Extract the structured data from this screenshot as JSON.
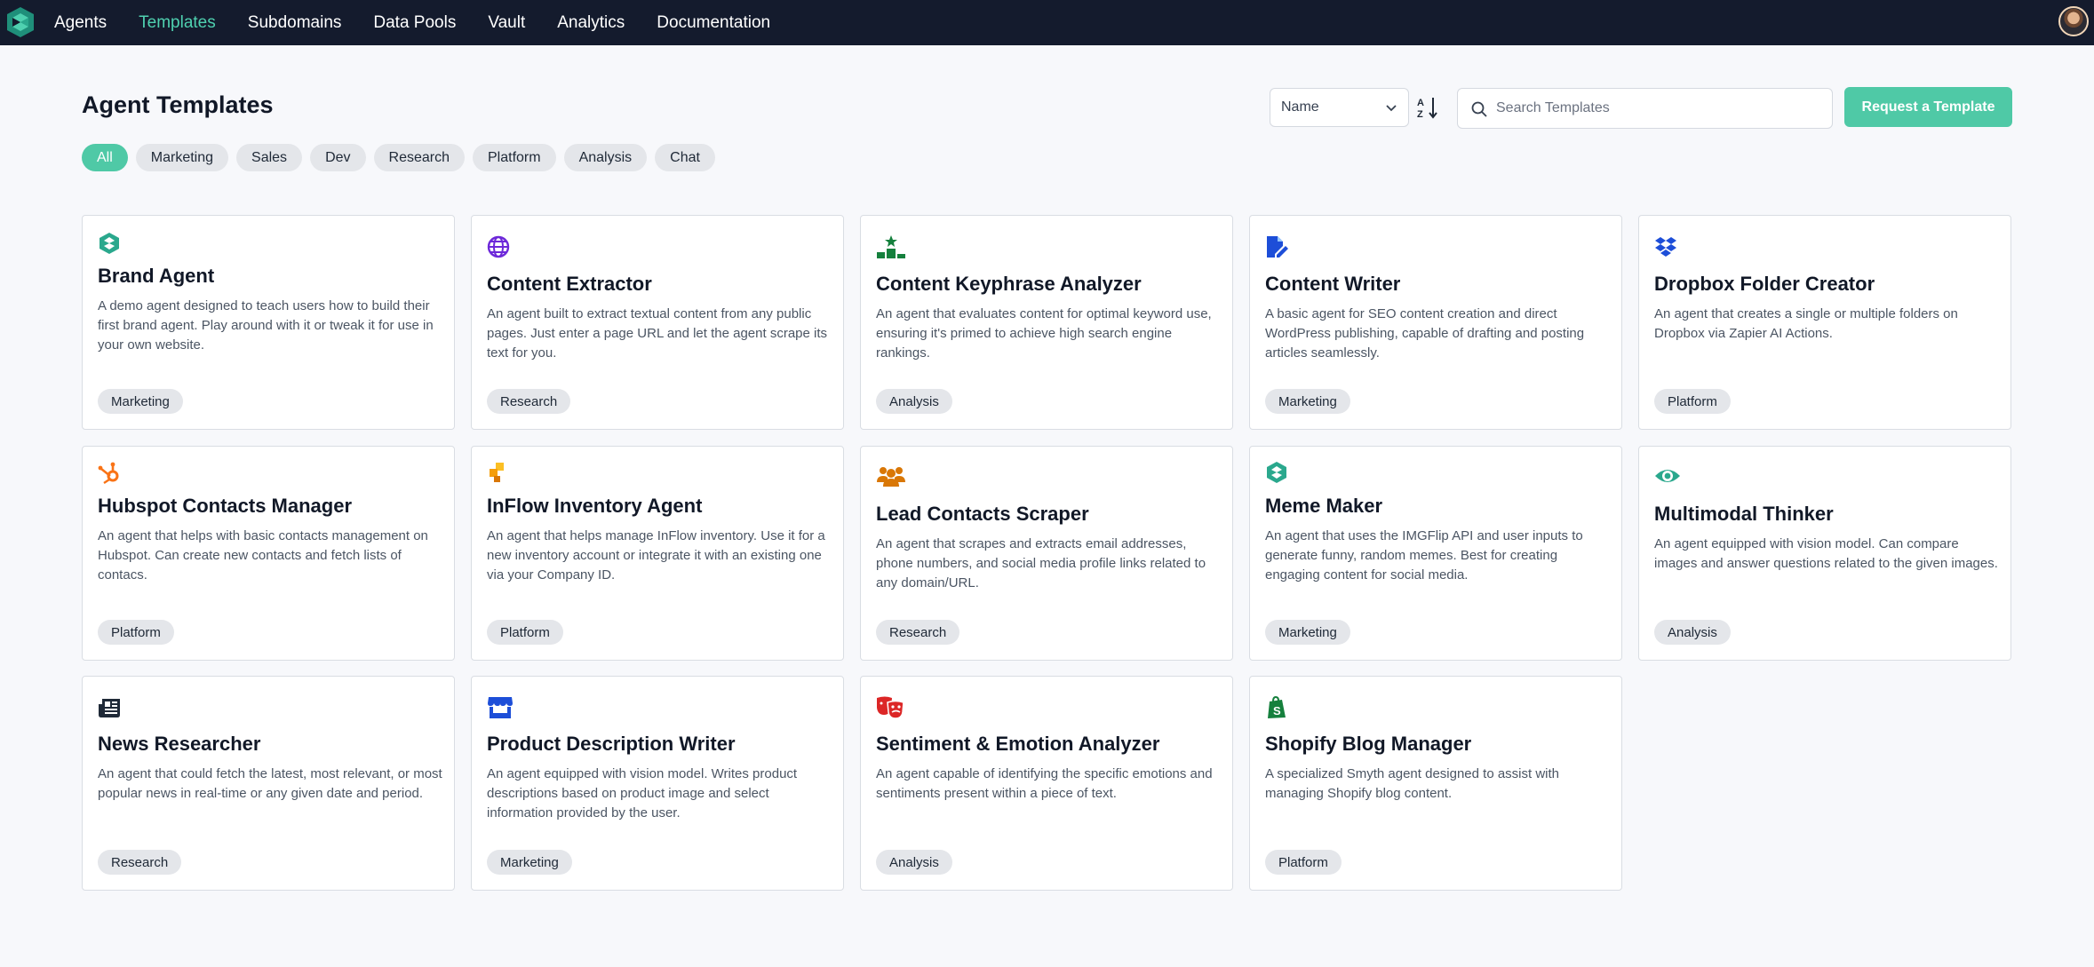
{
  "nav": {
    "items": [
      "Agents",
      "Templates",
      "Subdomains",
      "Data Pools",
      "Vault",
      "Analytics",
      "Documentation"
    ],
    "active": "Templates",
    "accent": "#4fd1b0",
    "background": "#141b2d"
  },
  "header": {
    "title": "Agent Templates",
    "sort_value": "Name",
    "search_placeholder": "Search Templates",
    "request_button": "Request a Template",
    "button_color": "#4fc9a6"
  },
  "filters": {
    "items": [
      "All",
      "Marketing",
      "Sales",
      "Dev",
      "Research",
      "Platform",
      "Analysis",
      "Chat"
    ],
    "active": "All"
  },
  "cards": [
    {
      "title": "Brand Agent",
      "desc": "A demo agent designed to teach users how to build their first brand agent. Play around with it or tweak it for use in your own website.",
      "tag": "Marketing",
      "icon": "smyth-logo-icon"
    },
    {
      "title": "Content Extractor",
      "desc": "An agent built to extract textual content from any public pages. Just enter a page URL and let the agent scrape its text for you.",
      "tag": "Research",
      "icon": "globe-icon"
    },
    {
      "title": "Content Keyphrase Analyzer",
      "desc": "An agent that evaluates content for optimal keyword use, ensuring it's primed to achieve high search engine rankings.",
      "tag": "Analysis",
      "icon": "ranking-podium-icon"
    },
    {
      "title": "Content Writer",
      "desc": "A basic agent for SEO content creation and direct WordPress publishing, capable of drafting and posting articles seamlessly.",
      "tag": "Marketing",
      "icon": "file-pen-icon"
    },
    {
      "title": "Dropbox Folder Creator",
      "desc": "An agent that creates a single or multiple folders on Dropbox via Zapier AI Actions.",
      "tag": "Platform",
      "icon": "dropbox-icon"
    },
    {
      "title": "Hubspot Contacts Manager",
      "desc": "An agent that helps with basic contacts management on Hubspot. Can create new contacts and fetch lists of contacs.",
      "tag": "Platform",
      "icon": "hubspot-icon"
    },
    {
      "title": "InFlow Inventory Agent",
      "desc": "An agent that helps manage InFlow inventory. Use it for a new inventory account or integrate it with an existing one via your Company ID.",
      "tag": "Platform",
      "icon": "inflow-icon"
    },
    {
      "title": "Lead Contacts Scraper",
      "desc": "An agent that scrapes and extracts email addresses, phone numbers, and social media profile links related to any domain/URL.",
      "tag": "Research",
      "icon": "users-icon"
    },
    {
      "title": "Meme Maker",
      "desc": "An agent that uses the IMGFlip API and user inputs to generate funny, random memes. Best for creating engaging content for social media.",
      "tag": "Marketing",
      "icon": "smyth-logo-icon"
    },
    {
      "title": "Multimodal Thinker",
      "desc": "An agent equipped with vision model. Can compare images and answer questions related to the given images.",
      "tag": "Analysis",
      "icon": "eye-icon"
    },
    {
      "title": "News Researcher",
      "desc": "An agent that could fetch the latest, most relevant, or most popular news in real-time or any given date and period.",
      "tag": "Research",
      "icon": "newspaper-icon"
    },
    {
      "title": "Product Description Writer",
      "desc": "An agent equipped with vision model. Writes product descriptions based on product  image and select information provided by the user.",
      "tag": "Marketing",
      "icon": "shop-icon"
    },
    {
      "title": "Sentiment & Emotion Analyzer",
      "desc": "An agent capable of identifying the specific emotions and sentiments present within a piece of text.",
      "tag": "Analysis",
      "icon": "masks-theater-icon"
    },
    {
      "title": "Shopify Blog Manager",
      "desc": "A specialized Smyth agent designed to assist with managing Shopify blog content.",
      "tag": "Platform",
      "icon": "shopify-icon"
    }
  ]
}
